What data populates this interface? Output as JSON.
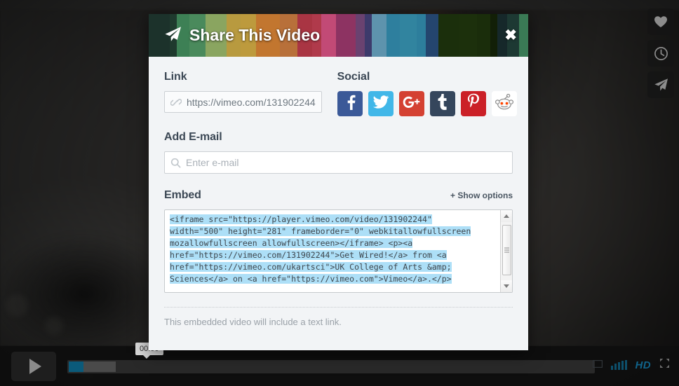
{
  "modal": {
    "title": "Share This Video",
    "title_icon": "paper-plane-icon",
    "close_label": "✖",
    "header_band_colors": [
      "#1c322b",
      "#1f3a2e",
      "#3d8055",
      "#4a8a5c",
      "#8aa560",
      "#b89a3f",
      "#bd9a3d",
      "#c2762f",
      "#b8703a",
      "#a93543",
      "#b03a4b",
      "#c24a76",
      "#8d3362",
      "#8e3462",
      "#6a4270",
      "#3d3a6b",
      "#5e93ad",
      "#2e7f9e",
      "#31849f",
      "#2d7e9c",
      "#24456e",
      "#1b2f0c",
      "#1c300c",
      "#1a2d0b",
      "#121f07",
      "#16282a",
      "#1d3933",
      "#3a7a55"
    ],
    "sections": {
      "link": {
        "title": "Link",
        "icon": "link-chain-icon",
        "value": "https://vimeo.com/131902244"
      },
      "social": {
        "title": "Social",
        "networks": [
          {
            "name": "facebook",
            "label": "Facebook",
            "color": "#3b5998"
          },
          {
            "name": "twitter",
            "label": "Twitter",
            "color": "#41b7e8"
          },
          {
            "name": "googleplus",
            "label": "Google Plus",
            "color": "#d44132"
          },
          {
            "name": "tumblr",
            "label": "Tumblr",
            "color": "#35465c"
          },
          {
            "name": "pinterest",
            "label": "Pinterest",
            "color": "#cb2027"
          },
          {
            "name": "reddit",
            "label": "Reddit",
            "color": "#ffffff"
          }
        ]
      },
      "email": {
        "title": "Add E-mail",
        "icon": "search-icon",
        "placeholder": "Enter e-mail",
        "value": ""
      },
      "embed": {
        "title": "Embed",
        "show_options_label": "+ Show options",
        "code": "<iframe src=\"https://player.vimeo.com/video/131902244\" width=\"500\" height=\"281\" frameborder=\"0\" webkitallowfullscreen mozallowfullscreen allowfullscreen></iframe> <p><a href=\"https://vimeo.com/131902244\">Get Wired!</a> from <a href=\"https://vimeo.com/ukartsci\">UK College of Arts &amp; Sciences</a> on <a href=\"https://vimeo.com\">Vimeo</a>.</p>",
        "code_lines": [
          "<iframe src=\"https://player.vimeo.com/video/131902244\"",
          "width=\"500\" height=\"281\" frameborder=\"0\" webkitallowfullscreen",
          "mozallowfullscreen allowfullscreen></iframe> <p><a",
          "href=\"https://vimeo.com/131902244\">Get Wired!</a> from <a",
          "href=\"https://vimeo.com/ukartsci\">UK College of Arts &amp;",
          "Sciences</a> on <a href=\"https://vimeo.com\">Vimeo</a>.</p>"
        ],
        "selection_color": "#addff7",
        "note": "This embedded video will include a text link."
      }
    }
  },
  "player": {
    "play_label": "Play",
    "current_time": "00:00",
    "progress_percent": 2.8,
    "buffered_percent": 9,
    "quality_badge": "HD",
    "accent_color": "#10638a",
    "controls": {
      "volume_label": "Volume",
      "fullscreen_label": "Fullscreen"
    }
  },
  "action_rail": [
    {
      "name": "like-button",
      "icon": "heart-icon",
      "label": "Like"
    },
    {
      "name": "watch-later-button",
      "icon": "clock-icon",
      "label": "Watch Later"
    },
    {
      "name": "share-button",
      "icon": "paper-plane-icon",
      "label": "Share"
    }
  ]
}
